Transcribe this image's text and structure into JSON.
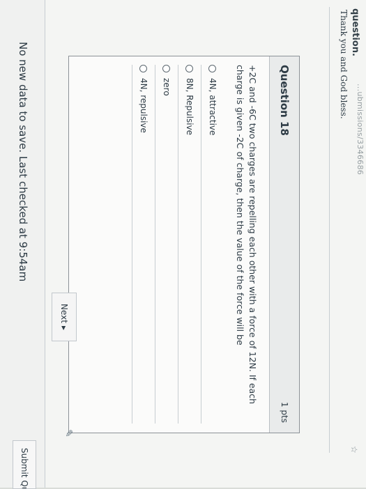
{
  "page": {
    "top_hint": "question.",
    "url_fragment": "...ubmissions/3346686",
    "thanks_text": "Thank you and God bless."
  },
  "question": {
    "title": "Question 18",
    "points": "1 pts",
    "text": "+2C and -6C two charges are repelling each other with a force of 12N. If each charge is given -2C of charge, then the value of the force will be",
    "options": [
      "4N, attractive",
      "8N, Repulsive",
      "zero",
      "4N, repulsive"
    ]
  },
  "navigation": {
    "next_label": "Next",
    "next_icon": "triangle-right-icon"
  },
  "footer": {
    "status_text": "No new data to save. Last checked at 9:54am",
    "submit_label": "Submit Qu"
  },
  "icons": {
    "pencil": "pencil-icon",
    "star": "star-icon"
  }
}
